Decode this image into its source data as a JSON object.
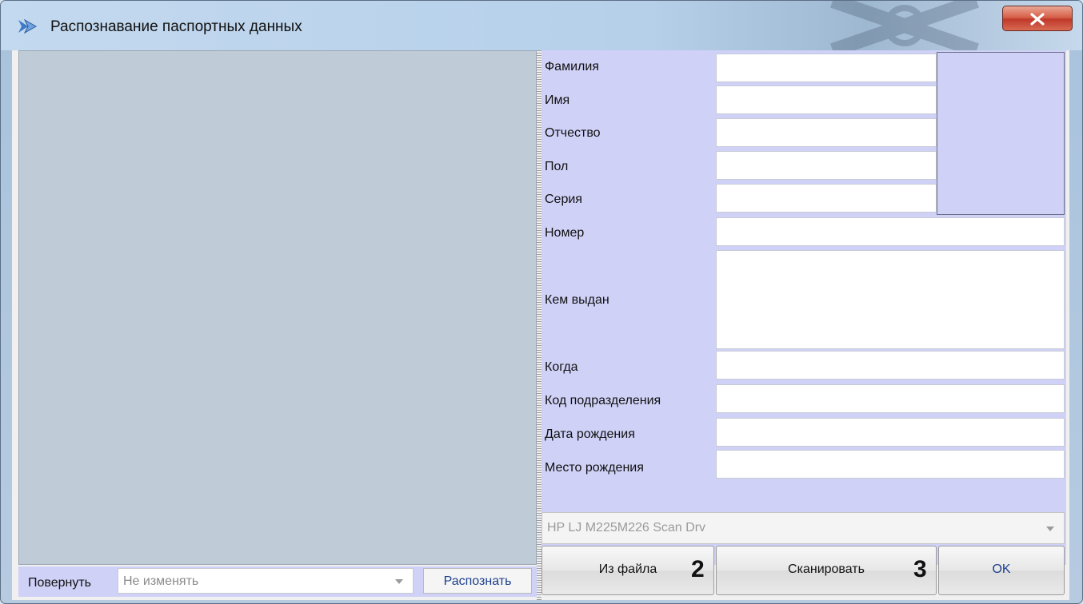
{
  "window": {
    "title": "Распознавание паспортных данных",
    "close_label": "x"
  },
  "image_panel": {
    "rotate_label": "Повернуть",
    "rotate_value": "Не изменять",
    "recognize_label": "Распознать"
  },
  "fields": [
    {
      "label": "Фамилия",
      "value": ""
    },
    {
      "label": "Имя",
      "value": ""
    },
    {
      "label": "Отчество",
      "value": ""
    },
    {
      "label": "Пол",
      "value": ""
    },
    {
      "label": "Серия",
      "value": ""
    },
    {
      "label": "Номер",
      "value": ""
    },
    {
      "label": "Кем выдан",
      "value": ""
    },
    {
      "label": "Когда",
      "value": ""
    },
    {
      "label": "Код подразделения",
      "value": ""
    },
    {
      "label": "Дата рождения",
      "value": ""
    },
    {
      "label": "Место рождения",
      "value": ""
    }
  ],
  "scanner": {
    "selected": "HP LJ M225M226 Scan Drv"
  },
  "buttons": {
    "from_file": "Из файла",
    "from_file_marker": "2",
    "scan": "Сканировать",
    "scan_marker": "3",
    "ok": "OK"
  },
  "colors": {
    "panel_background": "#cfd1f7",
    "link_text": "#1d3f8a",
    "close_button": "#c0392b"
  }
}
